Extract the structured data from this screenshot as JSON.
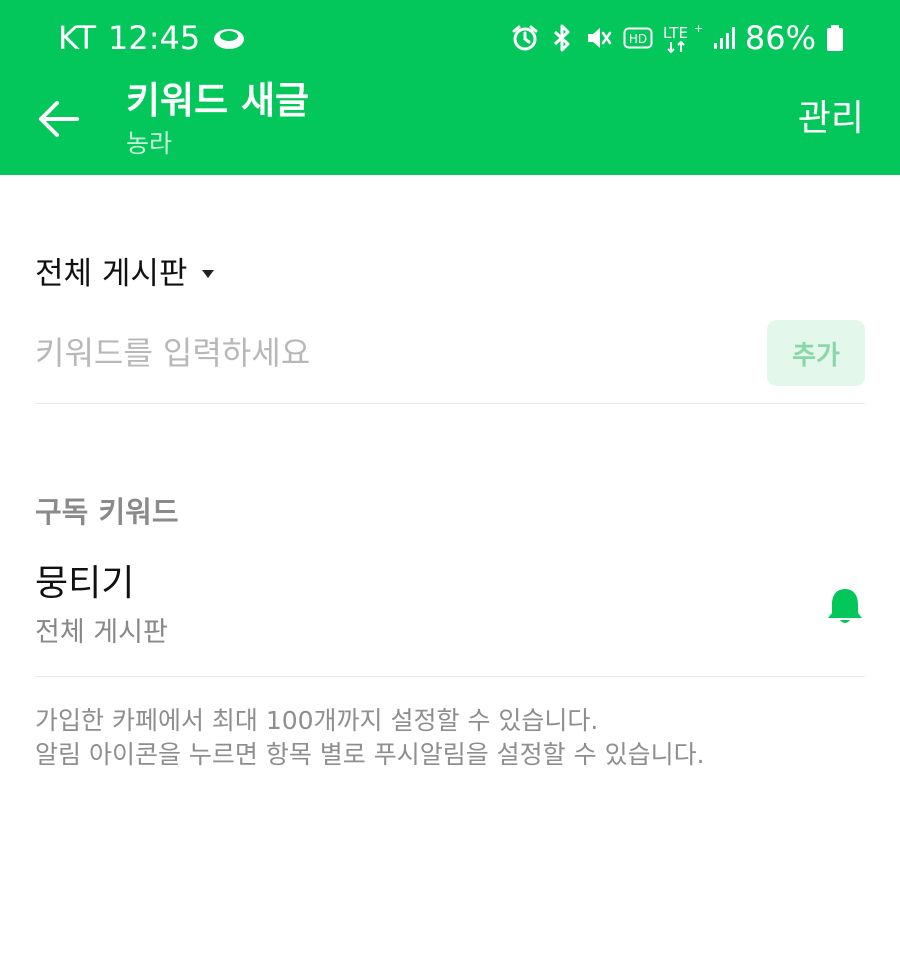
{
  "status_bar": {
    "carrier": "KT",
    "time": "12:45",
    "network": "LTE",
    "battery": "86%",
    "icons": [
      "notification-app-icon",
      "alarm-icon",
      "bluetooth-icon",
      "mute-icon",
      "hd-icon",
      "lte-icon",
      "signal-icon",
      "battery-icon"
    ]
  },
  "header": {
    "title": "키워드 새글",
    "subtitle": "농라",
    "manage_label": "관리",
    "background_color": "#03c75a",
    "back_icon": "arrow-left-icon"
  },
  "keyword_form": {
    "board_label": "전체 게시판",
    "input_placeholder": "키워드를 입력하세요",
    "input_value": "",
    "add_label": "추가"
  },
  "subscribed": {
    "section_title": "구독 키워드",
    "items": [
      {
        "keyword": "뭉티기",
        "board": "전체 게시판",
        "bell_on": true
      }
    ]
  },
  "info": {
    "line1": "가입한 카페에서 최대 100개까지 설정할 수 있습니다.",
    "line2": "알림 아이콘을 누르면 항목 별로 푸시알림을 설정할 수 있습니다."
  },
  "colors": {
    "accent": "#03c75a",
    "add_button_bg": "#e3f7ea",
    "add_button_text": "#89d6a7"
  }
}
